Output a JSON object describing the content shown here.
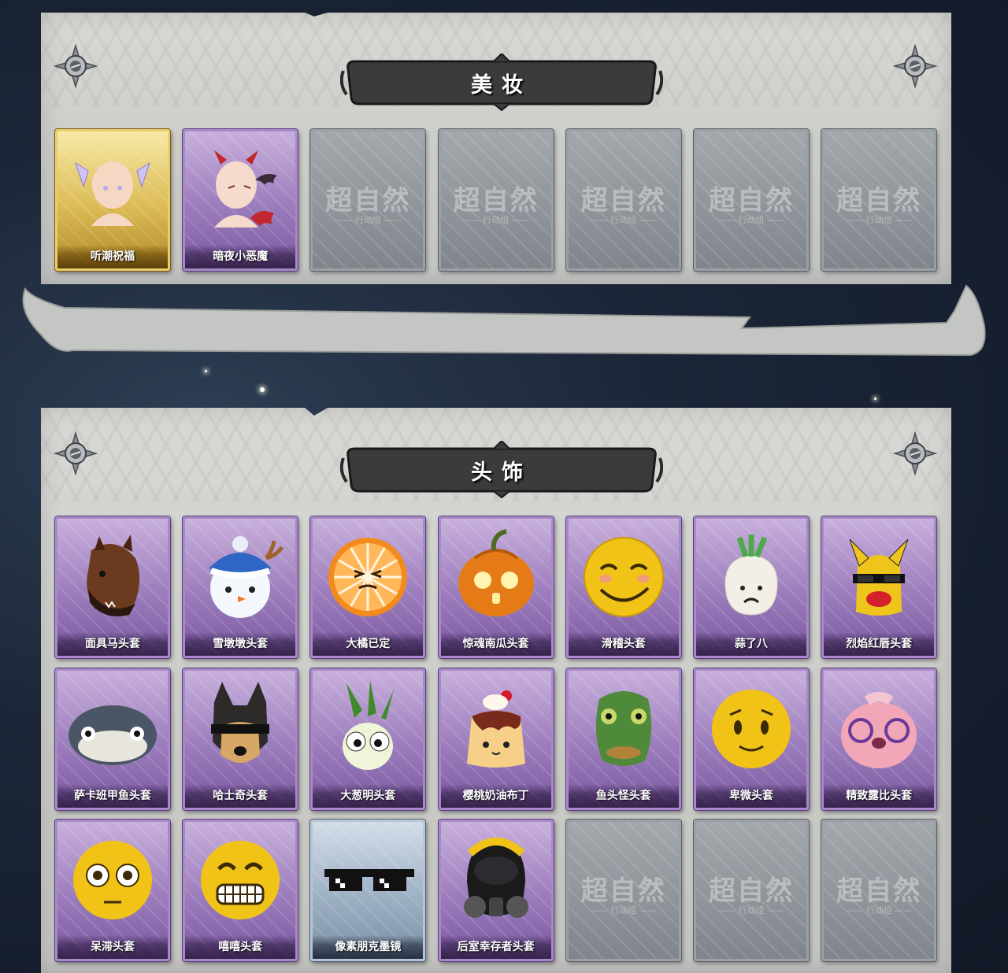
{
  "sections": [
    {
      "title": "美妆",
      "items": [
        {
          "name": "听潮祝福",
          "rarity": "gold",
          "icon": "blessing-bust-icon"
        },
        {
          "name": "暗夜小恶魔",
          "rarity": "purple",
          "icon": "devil-bust-icon"
        },
        {
          "name": "",
          "rarity": "empty",
          "icon": "empty-slot-icon"
        },
        {
          "name": "",
          "rarity": "empty",
          "icon": "empty-slot-icon"
        },
        {
          "name": "",
          "rarity": "empty",
          "icon": "empty-slot-icon"
        },
        {
          "name": "",
          "rarity": "empty",
          "icon": "empty-slot-icon"
        },
        {
          "name": "",
          "rarity": "empty",
          "icon": "empty-slot-icon"
        }
      ]
    },
    {
      "title": "头饰",
      "items": [
        {
          "name": "面具马头套",
          "rarity": "purple",
          "icon": "horse-mask-icon"
        },
        {
          "name": "雪墩墩头套",
          "rarity": "purple",
          "icon": "snowman-head-icon"
        },
        {
          "name": "大橘已定",
          "rarity": "purple",
          "icon": "orange-slice-icon"
        },
        {
          "name": "惊魂南瓜头套",
          "rarity": "purple",
          "icon": "pumpkin-head-icon"
        },
        {
          "name": "滑稽头套",
          "rarity": "purple",
          "icon": "smirk-face-icon"
        },
        {
          "name": "蒜了八",
          "rarity": "purple",
          "icon": "garlic-head-icon"
        },
        {
          "name": "烈焰红唇头套",
          "rarity": "purple",
          "icon": "pikachu-mask-icon"
        },
        {
          "name": "萨卡班甲鱼头套",
          "rarity": "purple",
          "icon": "fish-head-icon"
        },
        {
          "name": "哈士奇头套",
          "rarity": "purple",
          "icon": "husky-head-icon"
        },
        {
          "name": "大葱明头套",
          "rarity": "purple",
          "icon": "scallion-head-icon"
        },
        {
          "name": "樱桃奶油布丁",
          "rarity": "purple",
          "icon": "pudding-icon"
        },
        {
          "name": "鱼头怪头套",
          "rarity": "purple",
          "icon": "fish-monster-icon"
        },
        {
          "name": "卑微头套",
          "rarity": "purple",
          "icon": "humble-face-icon"
        },
        {
          "name": "精致露比头套",
          "rarity": "purple",
          "icon": "loopy-beaver-icon"
        },
        {
          "name": "呆滞头套",
          "rarity": "purple",
          "icon": "dazed-face-icon"
        },
        {
          "name": "嘻嘻头套",
          "rarity": "purple",
          "icon": "grin-face-icon"
        },
        {
          "name": "像素朋克墨镜",
          "rarity": "blue",
          "icon": "pixel-sunglasses-icon"
        },
        {
          "name": "后室幸存者头套",
          "rarity": "purple",
          "icon": "gas-mask-helmet-icon"
        },
        {
          "name": "",
          "rarity": "empty",
          "icon": "empty-slot-icon"
        },
        {
          "name": "",
          "rarity": "empty",
          "icon": "empty-slot-icon"
        },
        {
          "name": "",
          "rarity": "empty",
          "icon": "empty-slot-icon"
        }
      ]
    }
  ],
  "watermark": {
    "main": "超自然",
    "sub": "—— 行动组 ——"
  },
  "colors": {
    "purple": "#9b7cbc",
    "gold": "#dcbb55",
    "blue": "#9eb0c4",
    "empty": "#8d9398"
  }
}
